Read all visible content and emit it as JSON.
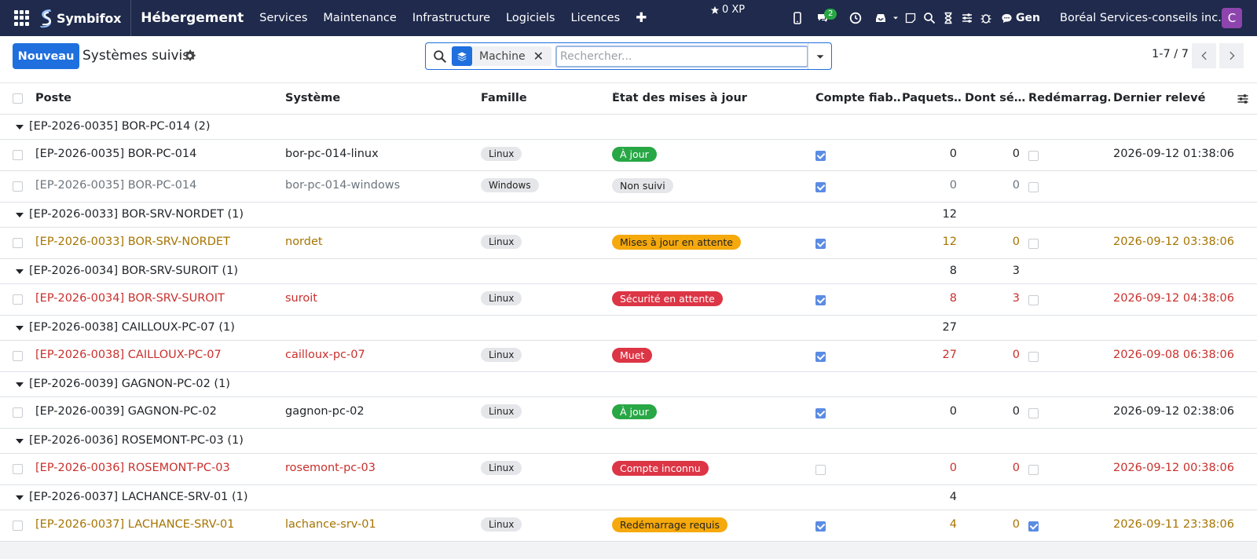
{
  "nav": {
    "brand": "Symbifox",
    "app_title": "Hébergement",
    "menu": [
      "Services",
      "Maintenance",
      "Infrastructure",
      "Logiciels",
      "Licences"
    ],
    "xp": "0 XP",
    "message_badge": "2",
    "gen_label": "Gen",
    "company": "Boréal Services-conseils inc.",
    "avatar_letter": "C"
  },
  "control": {
    "new_button": "Nouveau",
    "view_title": "Systèmes suivis",
    "facet_label": "Machine",
    "search_placeholder": "Rechercher...",
    "pager_value": "1-7 / 7"
  },
  "columns": {
    "poste": "Poste",
    "systeme": "Système",
    "famille": "Famille",
    "etat": "État des mises à jour",
    "compte": "Compte fiab…",
    "paquets": "Paquets…",
    "securite": "Dont sé…",
    "redemarrage": "Redémarrag…",
    "releve": "Dernier relevé"
  },
  "colors": {
    "success": "#28a745",
    "warning": "#f5a90c",
    "danger": "#dc3545",
    "neutral": "#e4e6e9",
    "nav_bg": "#1f2a4c",
    "primary": "#1f6fde"
  },
  "groups": [
    {
      "label": "[EP-2026-0035] BOR-PC-014 (2)",
      "sum_paquets": "",
      "sum_securite": "",
      "records": [
        {
          "poste": "[EP-2026-0035] BOR-PC-014",
          "systeme": "bor-pc-014-linux",
          "famille": "Linux",
          "etat": "À jour",
          "etat_style": "success",
          "compte": true,
          "paquets": "0",
          "securite": "0",
          "redemarrage": false,
          "releve": "2026-09-12 01:38:06",
          "tone": "normal"
        },
        {
          "poste": "[EP-2026-0035] BOR-PC-014",
          "systeme": "bor-pc-014-windows",
          "famille": "Windows",
          "etat": "Non suivi",
          "etat_style": "neutral",
          "compte": true,
          "paquets": "0",
          "securite": "0",
          "redemarrage": false,
          "releve": "",
          "tone": "muted"
        }
      ]
    },
    {
      "label": "[EP-2026-0033] BOR-SRV-NORDET (1)",
      "sum_paquets": "12",
      "sum_securite": "",
      "records": [
        {
          "poste": "[EP-2026-0033] BOR-SRV-NORDET",
          "systeme": "nordet",
          "famille": "Linux",
          "etat": "Mises à jour en attente",
          "etat_style": "warning",
          "compte": true,
          "paquets": "12",
          "securite": "0",
          "redemarrage": false,
          "releve": "2026-09-12 03:38:06",
          "tone": "warn"
        }
      ]
    },
    {
      "label": "[EP-2026-0034] BOR-SRV-SUROIT (1)",
      "sum_paquets": "8",
      "sum_securite": "3",
      "records": [
        {
          "poste": "[EP-2026-0034] BOR-SRV-SUROIT",
          "systeme": "suroit",
          "famille": "Linux",
          "etat": "Sécurité en attente",
          "etat_style": "danger",
          "compte": true,
          "paquets": "8",
          "securite": "3",
          "redemarrage": false,
          "releve": "2026-09-12 04:38:06",
          "tone": "danger"
        }
      ]
    },
    {
      "label": "[EP-2026-0038] CAILLOUX-PC-07 (1)",
      "sum_paquets": "27",
      "sum_securite": "",
      "records": [
        {
          "poste": "[EP-2026-0038] CAILLOUX-PC-07",
          "systeme": "cailloux-pc-07",
          "famille": "Linux",
          "etat": "Muet",
          "etat_style": "danger",
          "compte": true,
          "paquets": "27",
          "securite": "0",
          "redemarrage": false,
          "releve": "2026-09-08 06:38:06",
          "tone": "danger"
        }
      ]
    },
    {
      "label": "[EP-2026-0039] GAGNON-PC-02 (1)",
      "sum_paquets": "",
      "sum_securite": "",
      "records": [
        {
          "poste": "[EP-2026-0039] GAGNON-PC-02",
          "systeme": "gagnon-pc-02",
          "famille": "Linux",
          "etat": "À jour",
          "etat_style": "success",
          "compte": true,
          "paquets": "0",
          "securite": "0",
          "redemarrage": false,
          "releve": "2026-09-12 02:38:06",
          "tone": "normal"
        }
      ]
    },
    {
      "label": "[EP-2026-0036] ROSEMONT-PC-03 (1)",
      "sum_paquets": "",
      "sum_securite": "",
      "records": [
        {
          "poste": "[EP-2026-0036] ROSEMONT-PC-03",
          "systeme": "rosemont-pc-03",
          "famille": "Linux",
          "etat": "Compte inconnu",
          "etat_style": "danger",
          "compte": false,
          "paquets": "0",
          "securite": "0",
          "redemarrage": false,
          "releve": "2026-09-12 00:38:06",
          "tone": "danger"
        }
      ]
    },
    {
      "label": "[EP-2026-0037] LACHANCE-SRV-01 (1)",
      "sum_paquets": "4",
      "sum_securite": "",
      "records": [
        {
          "poste": "[EP-2026-0037] LACHANCE-SRV-01",
          "systeme": "lachance-srv-01",
          "famille": "Linux",
          "etat": "Redémarrage requis",
          "etat_style": "warning",
          "compte": true,
          "paquets": "4",
          "securite": "0",
          "redemarrage": true,
          "releve": "2026-09-11 23:38:06",
          "tone": "warn"
        }
      ]
    }
  ]
}
